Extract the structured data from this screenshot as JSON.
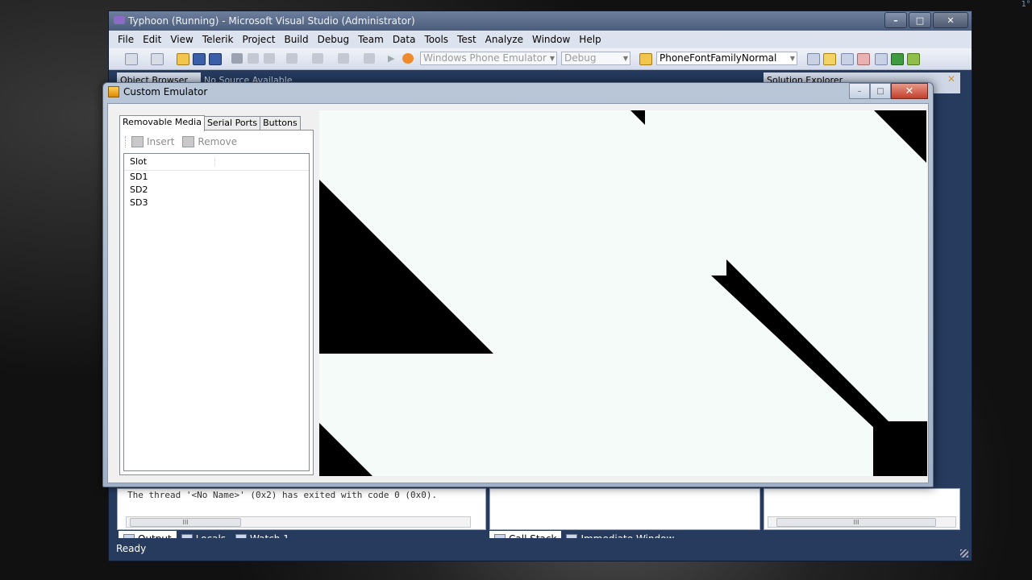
{
  "window": {
    "title": "Typhoon (Running) - Microsoft Visual Studio (Administrator)",
    "caption_buttons": [
      "minimize",
      "maximize",
      "close"
    ]
  },
  "menu": [
    "File",
    "Edit",
    "View",
    "Telerik",
    "Project",
    "Build",
    "Debug",
    "Team",
    "Data",
    "Tools",
    "Test",
    "Analyze",
    "Window",
    "Help"
  ],
  "toolbar": {
    "target_combo": "Windows Phone Emulator",
    "config_combo": "Debug",
    "find_combo": "PhoneFontFamilyNormal"
  },
  "panels": {
    "object_browser": "Object Browser",
    "no_source": "No Source Available",
    "solution_explorer": "Solution Explorer",
    "output_text": "The thread '<No Name>' (0x2) has exited with code 0 (0x0).",
    "scroll_thumb": "III"
  },
  "bottom_tabs_left": [
    {
      "label": "Output",
      "icon": "output-icon",
      "selected": true
    },
    {
      "label": "Locals",
      "icon": "locals-icon",
      "selected": false
    },
    {
      "label": "Watch 1",
      "icon": "watch-icon",
      "selected": false
    }
  ],
  "bottom_tabs_mid": [
    {
      "label": "Call Stack",
      "icon": "call-stack-icon",
      "selected": true
    },
    {
      "label": "Immediate Window",
      "icon": "immediate-window-icon",
      "selected": false
    }
  ],
  "status": "Ready",
  "desktop_corner": "1°",
  "emulator": {
    "title": "Custom Emulator",
    "tabs": [
      "Removable Media",
      "Serial Ports",
      "Buttons"
    ],
    "selected_tab": "Removable Media",
    "insert_label": "Insert",
    "remove_label": "Remove",
    "column_header": "Slot",
    "slots": [
      "SD1",
      "SD2",
      "SD3"
    ]
  }
}
